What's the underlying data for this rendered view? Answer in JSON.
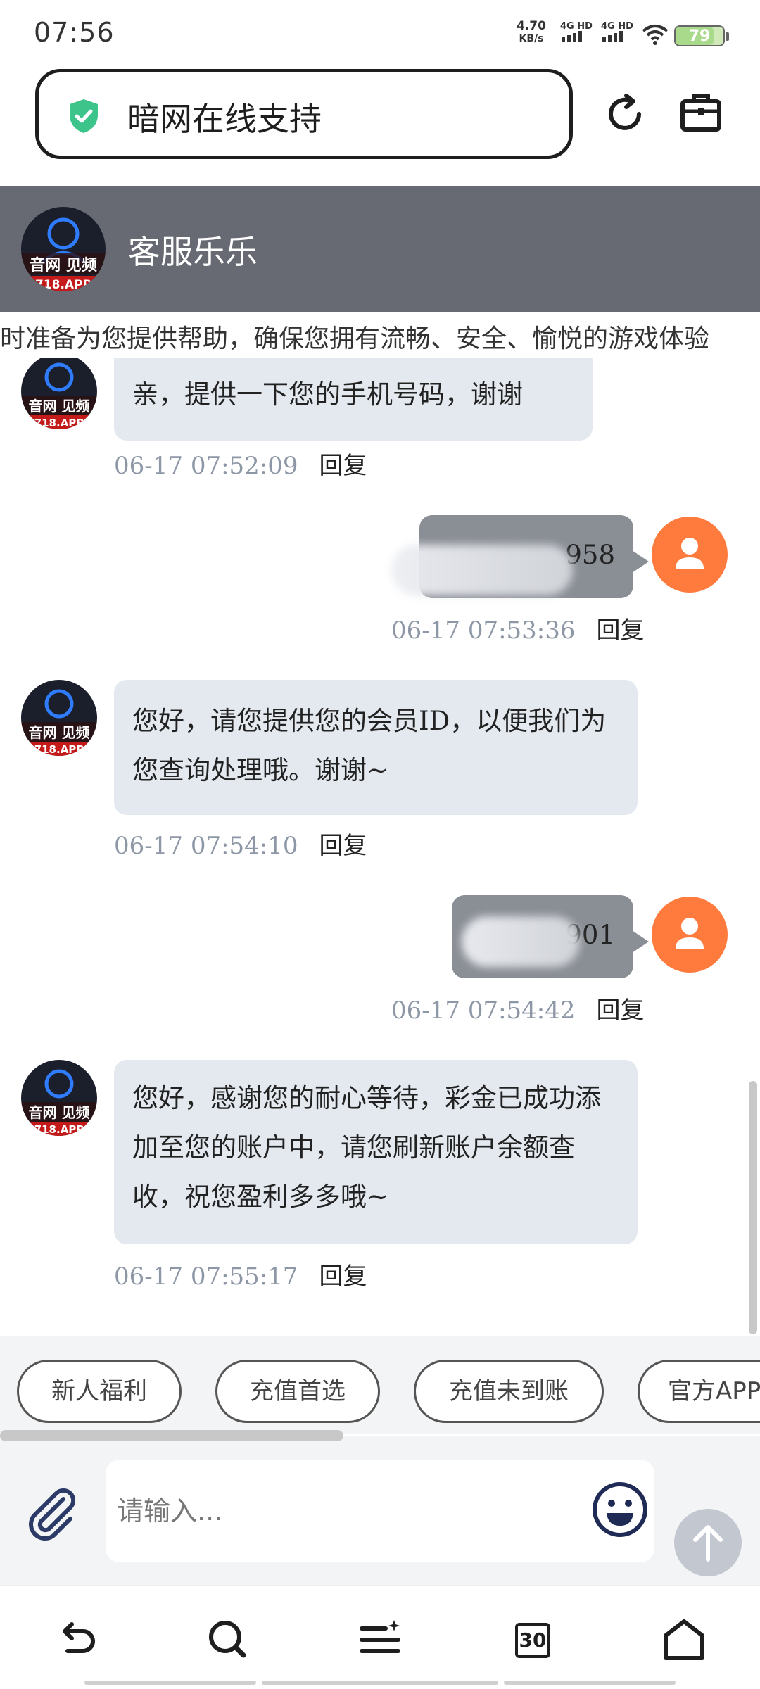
{
  "status_bar": {
    "time": "07:56",
    "speed_value": "4.70",
    "speed_unit": "KB/s",
    "net1": "4G HD",
    "net2": "4G HD",
    "battery": "79"
  },
  "browser": {
    "title": "暗网在线支持"
  },
  "chat_header": {
    "agent_name": "客服乐乐",
    "avatar_line1": "音网 见频",
    "avatar_line2": "718.APP"
  },
  "marquee": "时准备为您提供帮助，确保您拥有流畅、安全、愉悦的游戏体验",
  "messages": [
    {
      "direction": "incoming",
      "text": "亲，提供一下您的手机号码，谢谢",
      "time": "06-17 07:52:09",
      "reply": "回复"
    },
    {
      "direction": "outgoing",
      "text": "958",
      "time": "06-17 07:53:36",
      "reply": "回复"
    },
    {
      "direction": "incoming",
      "text": "您好，请您提供您的会员ID，以便我们为您查询处理哦。谢谢~",
      "time": "06-17 07:54:10",
      "reply": "回复"
    },
    {
      "direction": "outgoing",
      "text": "901",
      "time": "06-17 07:54:42",
      "reply": "回复"
    },
    {
      "direction": "incoming",
      "text": "您好，感谢您的耐心等待，彩金已成功添加至您的账户中，请您刷新账户余额查收，祝您盈利多多哦~",
      "time": "06-17 07:55:17",
      "reply": "回复"
    }
  ],
  "quick_replies": [
    "新人福利",
    "充值首选",
    "充值未到账",
    "官方APP"
  ],
  "composer": {
    "placeholder": "请输入..."
  },
  "bottom_nav": {
    "tab_count": "30"
  },
  "colors": {
    "header_bg": "#676a72",
    "incoming_bubble": "#e4e9f0",
    "outgoing_bubble": "#8a8e95",
    "user_avatar": "#ff7a3d",
    "shield": "#3cc48a"
  }
}
